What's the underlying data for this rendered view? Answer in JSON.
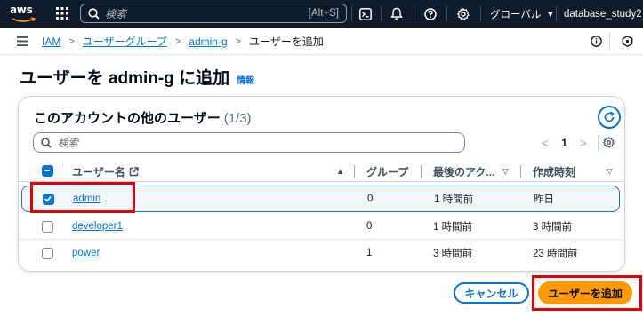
{
  "topnav": {
    "logo": "aws",
    "search_placeholder": "検索",
    "search_shortcut": "[Alt+S]",
    "region": "グローバル",
    "account": "database_study2"
  },
  "breadcrumb": {
    "items": [
      "IAM",
      "ユーザーグループ",
      "admin-g"
    ],
    "current": "ユーザーを追加"
  },
  "page": {
    "title": "ユーザーを admin-g に追加",
    "info_link": "情報"
  },
  "table_panel": {
    "title": "このアカウントの他のユーザー",
    "count": "(1/3)",
    "filter_placeholder": "検索",
    "page_number": "1",
    "columns": [
      "ユーザー名",
      "グループ",
      "最後のアク...",
      "作成時刻"
    ],
    "rows": [
      {
        "name": "admin",
        "groups": "0",
        "last_activity": "1 時間前",
        "created": "昨日",
        "selected": true
      },
      {
        "name": "developer1",
        "groups": "0",
        "last_activity": "1 時間前",
        "created": "3 時間前",
        "selected": false
      },
      {
        "name": "power",
        "groups": "1",
        "last_activity": "3 時間前",
        "created": "23 時間前",
        "selected": false
      }
    ]
  },
  "actions": {
    "cancel": "キャンセル",
    "add": "ユーザーを追加"
  },
  "colors": {
    "nav_bg": "#0f1b2a",
    "link": "#0972d3",
    "primary_button": "#ff9900",
    "highlight": "#e00000"
  }
}
